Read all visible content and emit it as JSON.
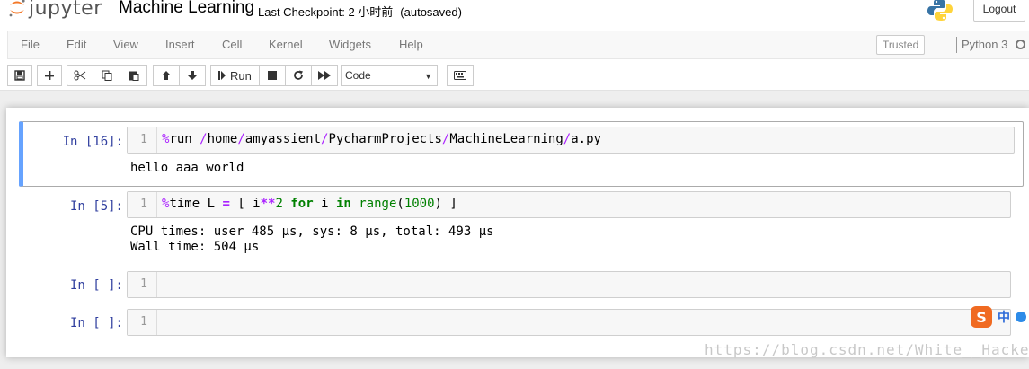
{
  "header": {
    "logo_text": "jupyter",
    "notebook_title": "Machine Learning",
    "checkpoint": "Last Checkpoint: 2 小时前",
    "autosave_status": "(autosaved)",
    "logout_label": "Logout"
  },
  "menubar": {
    "items": [
      "File",
      "Edit",
      "View",
      "Insert",
      "Cell",
      "Kernel",
      "Widgets",
      "Help"
    ],
    "trusted_label": "Trusted",
    "kernel_name": "Python 3"
  },
  "toolbar": {
    "run_label": "Run",
    "cell_type": "Code",
    "buttons": [
      "save-icon",
      "plus-icon",
      "cut-icon",
      "copy-icon",
      "paste-icon",
      "arrow-up-icon",
      "arrow-down-icon",
      "run-icon",
      "stop-icon",
      "restart-icon",
      "fast-forward-icon",
      "keyboard-icon"
    ]
  },
  "cells": [
    {
      "prompt": "In [16]:",
      "line_number": "1",
      "code": "%run /home/amyassient/PycharmProjects/MachineLearning/a.py",
      "output": "hello aaa world",
      "selected": true
    },
    {
      "prompt": "In [5]:",
      "line_number": "1",
      "code": "%time L = [ i**2 for i in range(1000) ]",
      "output": "CPU times: user 485 µs, sys: 8 µs, total: 493 µs\nWall time: 504 µs",
      "selected": false
    },
    {
      "prompt": "In [ ]:",
      "line_number": "1",
      "code": "",
      "output": "",
      "selected": false
    },
    {
      "prompt": "In [ ]:",
      "line_number": "1",
      "code": "",
      "output": "",
      "selected": false
    }
  ],
  "ime": {
    "logo": "S",
    "mode": "中"
  },
  "watermark": "https://blog.csdn.net/White__Hacker",
  "colors": {
    "prompt": "#303f9f",
    "selected_border": "#66a3ff",
    "magic": "#aa22ff",
    "keyword": "#008000",
    "ime_orange": "#f06a21"
  }
}
